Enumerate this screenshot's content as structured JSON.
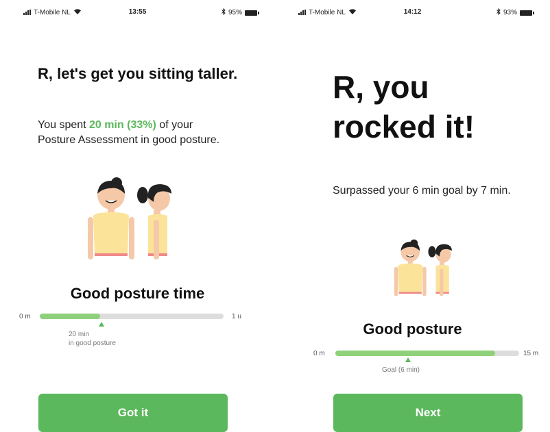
{
  "left_screen": {
    "status": {
      "carrier": "T-Mobile NL",
      "time": "13:55",
      "battery": "95%"
    },
    "title": "R, let's get you sitting taller.",
    "desc": {
      "pre": "You spent ",
      "highlight": "20 min (33%)",
      "post": " of your Posture Assessment in good posture."
    },
    "section_title": "Good posture time",
    "progress": {
      "fill_fraction": 0.33,
      "min_label": "0 m",
      "max_label": "1 u"
    },
    "marker_label": "20 min\nin good posture",
    "button": "Got it"
  },
  "right_screen": {
    "status": {
      "carrier": "T-Mobile NL",
      "time": "14:12",
      "battery": "93%"
    },
    "title": "R, you rocked it!",
    "desc": "Surpassed your 6 min goal by 7 min.",
    "section_title": "Good posture",
    "progress": {
      "fill_fraction": 0.87,
      "min_label": "0 m",
      "max_label": "15 m"
    },
    "marker_label": "Goal (6 min)",
    "button": "Next"
  },
  "colors": {
    "accent": "#5cb85c",
    "bar_fill": "#8fd17a",
    "track": "#dddddd",
    "shirt": "#fbe39a",
    "skin": "#f5c9a8"
  },
  "icons": [
    "signal-bars-icon",
    "wifi-icon",
    "bluetooth-icon",
    "battery-icon",
    "goal-marker-icon"
  ]
}
